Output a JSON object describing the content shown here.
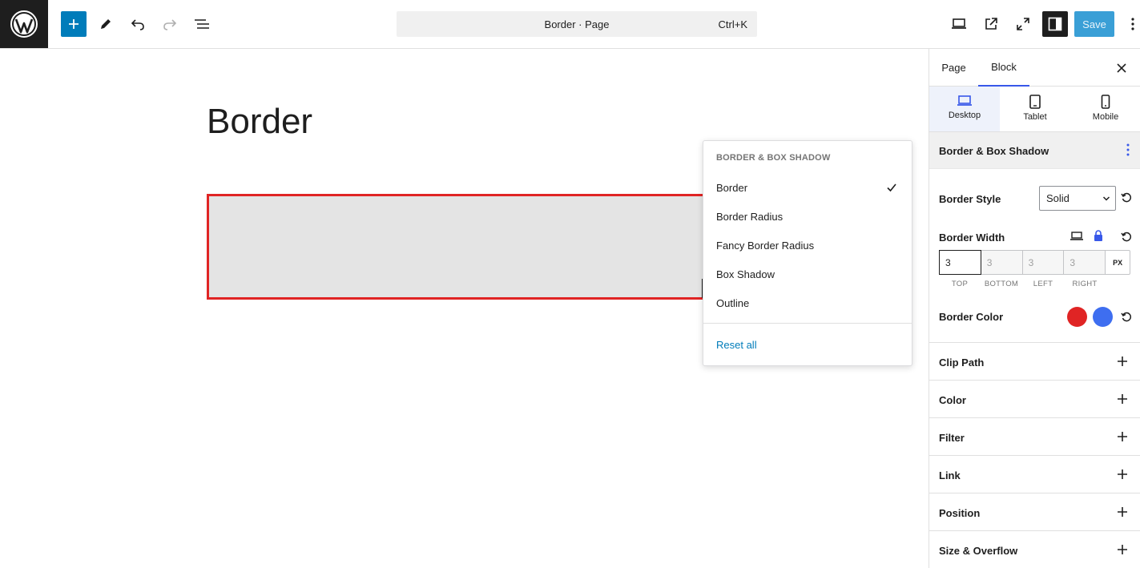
{
  "topbar": {
    "document_title": "Border · Page",
    "shortcut": "Ctrl+K",
    "save_label": "Save",
    "icons": [
      "wordpress-logo-icon",
      "plus-icon",
      "pencil-icon",
      "undo-icon",
      "redo-icon",
      "list-view-icon",
      "desktop-preview-icon",
      "external-link-icon",
      "fullscreen-icon",
      "sidebar-toggle-icon",
      "more-vertical-icon"
    ]
  },
  "canvas": {
    "page_title": "Border",
    "block_colors": {
      "background": "#e4e4e4",
      "border": "#e02424"
    }
  },
  "dropdown": {
    "heading": "BORDER & BOX SHADOW",
    "items": [
      {
        "label": "Border",
        "checked": true
      },
      {
        "label": "Border Radius",
        "checked": false
      },
      {
        "label": "Fancy Border Radius",
        "checked": false
      },
      {
        "label": "Box Shadow",
        "checked": false
      },
      {
        "label": "Outline",
        "checked": false
      }
    ],
    "reset_label": "Reset all"
  },
  "sidebar": {
    "tabs": [
      {
        "label": "Page",
        "active": false
      },
      {
        "label": "Block",
        "active": true
      }
    ],
    "devices": [
      {
        "label": "Desktop",
        "active": true
      },
      {
        "label": "Tablet",
        "active": false
      },
      {
        "label": "Mobile",
        "active": false
      }
    ],
    "panel_title": "Border & Box Shadow",
    "border_style": {
      "label": "Border Style",
      "value": "Solid"
    },
    "border_width": {
      "label": "Border Width",
      "values": [
        "3",
        "3",
        "3",
        "3"
      ],
      "unit": "PX",
      "sides": [
        "TOP",
        "BOTTOM",
        "LEFT",
        "RIGHT"
      ]
    },
    "border_color": {
      "label": "Border Color",
      "colors": [
        "#e02424",
        "#3e6ef0"
      ]
    },
    "sections": [
      "Clip Path",
      "Color",
      "Filter",
      "Link",
      "Position",
      "Size & Overflow"
    ]
  },
  "colors": {
    "accent": "#007cba",
    "tab_indicator": "#3858e9"
  }
}
